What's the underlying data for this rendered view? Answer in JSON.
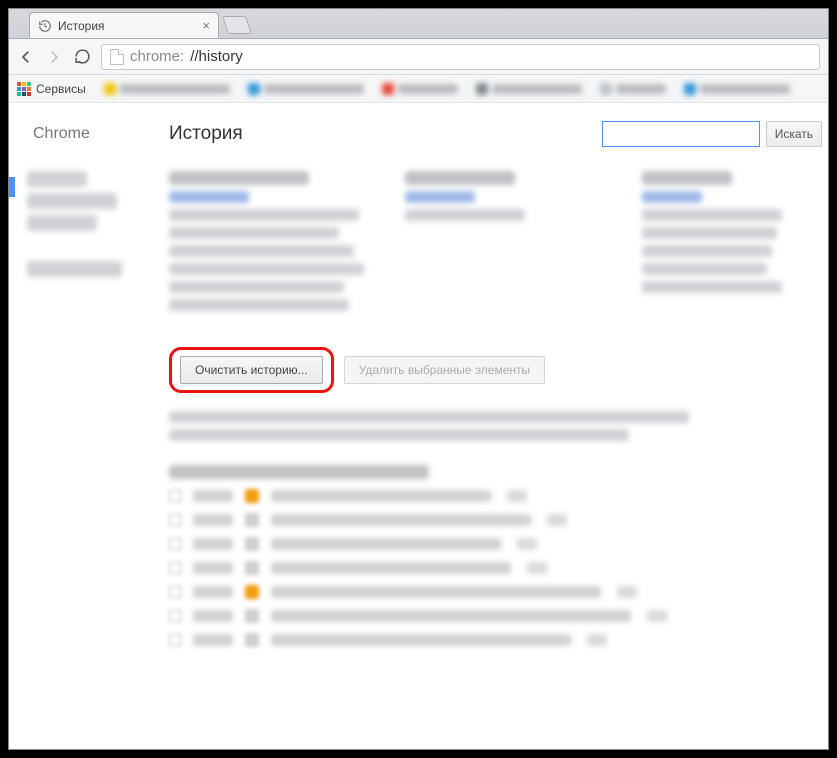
{
  "tab": {
    "title": "История"
  },
  "omnibox": {
    "scheme": "chrome:",
    "path": "//history"
  },
  "bookmarks": {
    "apps_label": "Сервисы"
  },
  "page": {
    "brand": "Chrome",
    "title": "История",
    "search_button": "Искать"
  },
  "actions": {
    "clear_history": "Очистить историю...",
    "delete_selected": "Удалить выбранные элементы"
  }
}
